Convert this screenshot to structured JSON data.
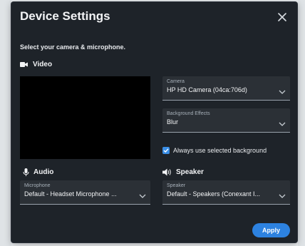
{
  "dialog": {
    "title": "Device Settings",
    "subtitle": "Select your camera & microphone."
  },
  "video": {
    "label": "Video",
    "camera": {
      "label": "Camera",
      "value": "HP HD Camera (04ca:706d)"
    },
    "background": {
      "label": "Background Effects",
      "value": "Blur"
    },
    "checkbox_label": "Always use selected background",
    "checkbox_checked": true
  },
  "audio": {
    "label": "Audio",
    "microphone": {
      "label": "Microphone",
      "value": "Default - Headset Microphone ..."
    }
  },
  "speaker": {
    "label": "Speaker",
    "output": {
      "label": "Speaker",
      "value": "Default - Speakers (Conexant I..."
    }
  },
  "buttons": {
    "apply": "Apply"
  },
  "colors": {
    "accent": "#2d82e0",
    "dialog_bg": "#1e2329"
  }
}
